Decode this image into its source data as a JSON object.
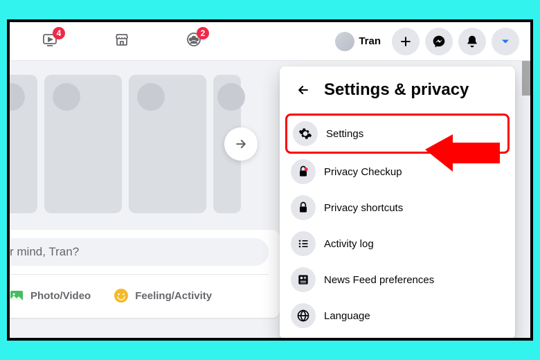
{
  "topbar": {
    "watch_badge": "4",
    "groups_badge": "2",
    "profile_name": "Tran"
  },
  "composer": {
    "placeholder": "r mind, Tran?",
    "photo_label": "Photo/Video",
    "feeling_label": "Feeling/Activity"
  },
  "dropdown": {
    "title": "Settings & privacy",
    "items": [
      {
        "label": "Settings"
      },
      {
        "label": "Privacy Checkup"
      },
      {
        "label": "Privacy shortcuts"
      },
      {
        "label": "Activity log"
      },
      {
        "label": "News Feed preferences"
      },
      {
        "label": "Language"
      }
    ]
  }
}
